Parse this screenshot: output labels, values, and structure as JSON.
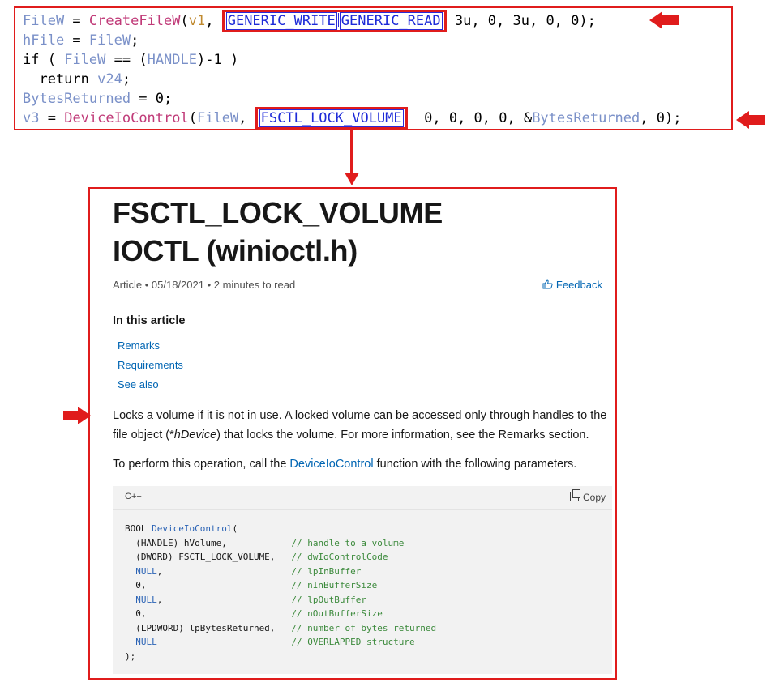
{
  "decompiled": {
    "line1": {
      "lhs": "FileW",
      "eq": " = ",
      "func": "CreateFileW",
      "open": "(",
      "arg1": "v1",
      "c1": ", ",
      "hl_a": "GENERIC_WRITE",
      "hl_b": "GENERIC_READ",
      "rest": "3u, 0, 3u, 0, 0);"
    },
    "line2": {
      "lhs": "hFile",
      "eq": " = ",
      "rhs": "FileW",
      "end": ";"
    },
    "line3": {
      "kw": "if",
      "p1": " ( ",
      "var": "FileW",
      "mid": " == (",
      "handle": "HANDLE",
      "tail": ")-1 )"
    },
    "line4": {
      "kw": "  return ",
      "var": "v24",
      "end": ";"
    },
    "line5": {
      "lhs": "BytesReturned",
      "rest": " = 0;"
    },
    "line6": {
      "lhs": "v3",
      "eq": " = ",
      "func": "DeviceIoControl",
      "open": "(",
      "arg1": "FileW",
      "c1": ", ",
      "hl": "FSCTL_LOCK_VOLUME",
      "rest1": "  0, 0, 0, 0, &",
      "br": "BytesReturned",
      "rest2": ", 0);"
    }
  },
  "doc": {
    "title": "FSCTL_LOCK_VOLUME IOCTL (winioctl.h)",
    "meta": "Article • 05/18/2021 • 2 minutes to read",
    "feedback": "Feedback",
    "toc_heading": "In this article",
    "toc": [
      "Remarks",
      "Requirements",
      "See also"
    ],
    "para1_a": "Locks a volume if it is not in use. A locked volume can be accessed only through handles to the file object (*",
    "para1_em": "hDevice",
    "para1_b": ") that locks the volume. For more information, see the Remarks section.",
    "para2_a": "To perform this operation, call the ",
    "para2_link": "DeviceIoControl",
    "para2_b": " function with the following parameters.",
    "code_lang": "C++",
    "copy_label": "Copy",
    "code_lines": [
      {
        "a": "BOOL ",
        "fn": "DeviceIoControl",
        "b": "(",
        "c": ""
      },
      {
        "a": "  (HANDLE) hVolume,",
        "b": "",
        "c": "// handle to a volume"
      },
      {
        "a": "  (DWORD) FSCTL_LOCK_VOLUME,",
        "b": "",
        "c": "// dwIoControlCode"
      },
      {
        "a": "  ",
        "k": "NULL",
        "b": ",",
        "c": "// lpInBuffer"
      },
      {
        "a": "  0,",
        "b": "",
        "c": "// nInBufferSize"
      },
      {
        "a": "  ",
        "k": "NULL",
        "b": ",",
        "c": "// lpOutBuffer"
      },
      {
        "a": "  0,",
        "b": "",
        "c": "// nOutBufferSize"
      },
      {
        "a": "  (LPDWORD) lpBytesReturned,",
        "b": "",
        "c": "// number of bytes returned"
      },
      {
        "a": "  ",
        "k": "NULL",
        "b": "",
        "c": "// OVERLAPPED structure"
      },
      {
        "a": ");",
        "b": "",
        "c": ""
      }
    ]
  },
  "colors": {
    "annotation": "#e01c1c",
    "link": "#0065b3",
    "highlight_text": "#1d2ad8"
  }
}
